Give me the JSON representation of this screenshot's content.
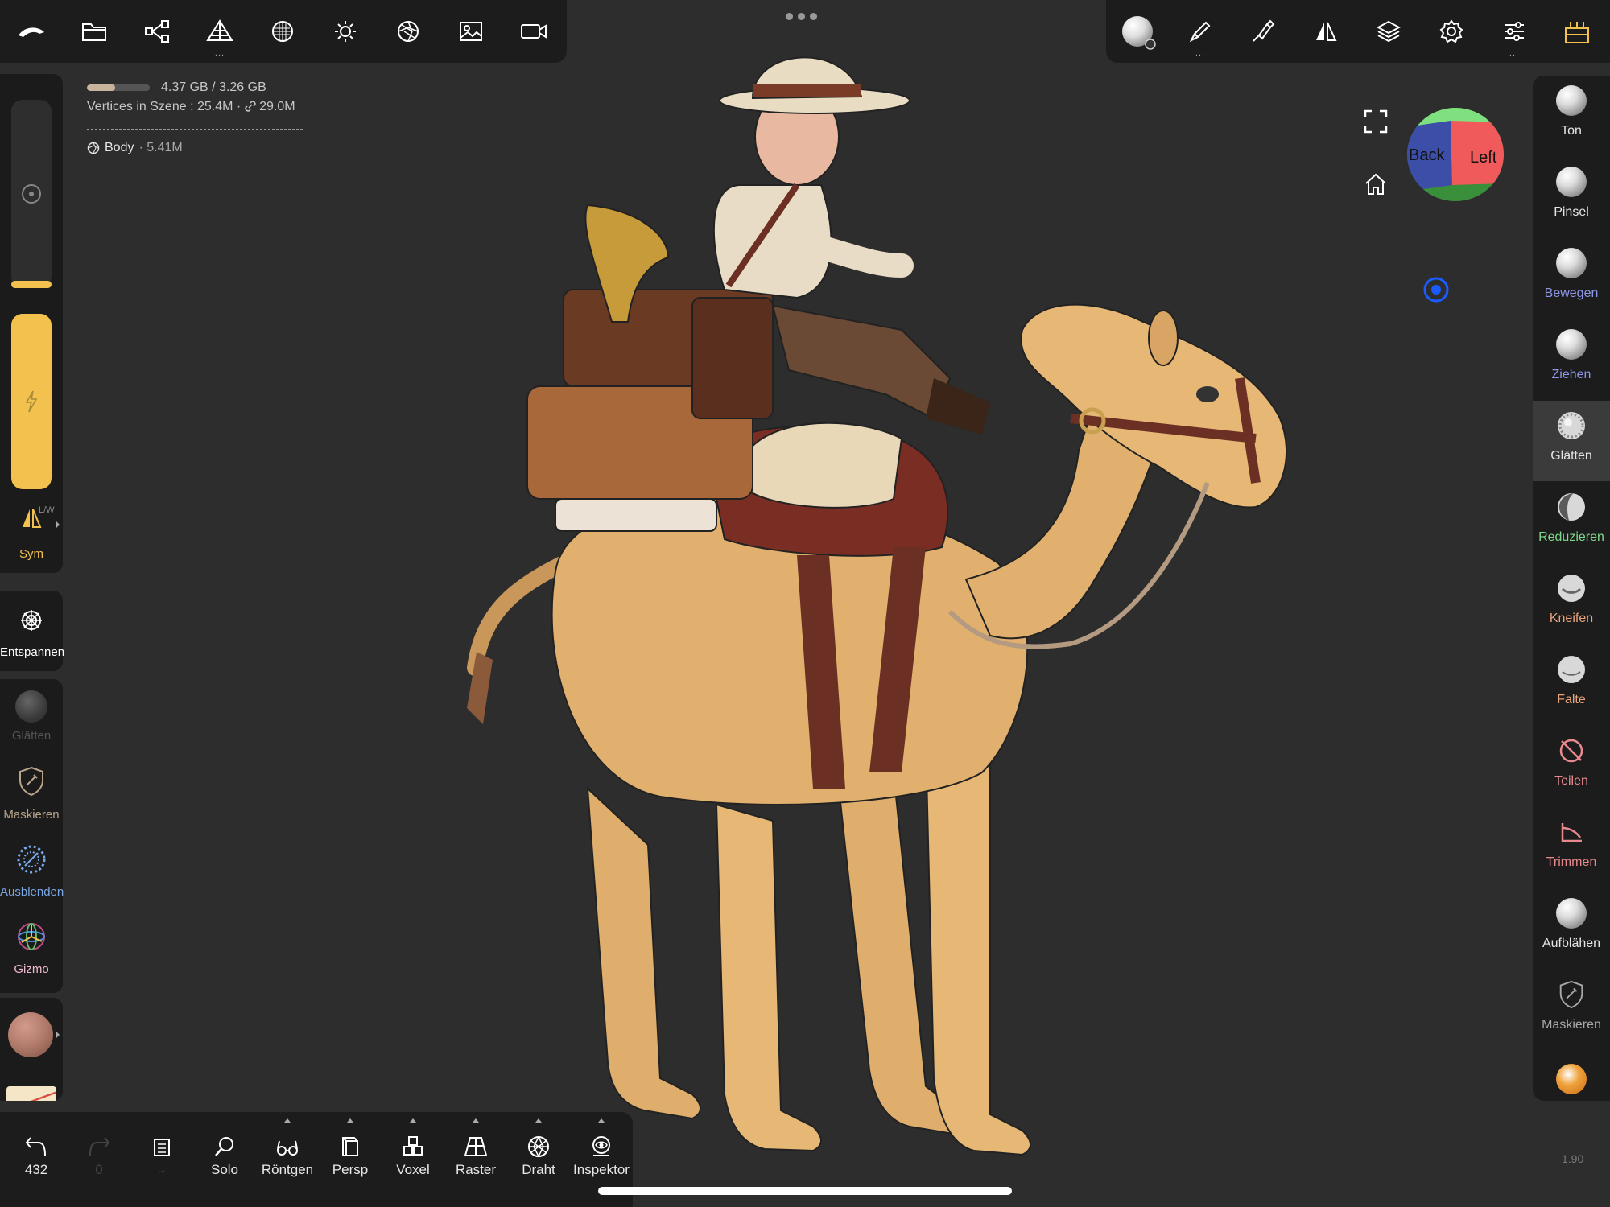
{
  "top_left_toolbar": {
    "icons": [
      "nomad-logo-icon",
      "folder-icon",
      "scene-graph-icon",
      "topology-icon",
      "material-icon",
      "light-icon",
      "shading-icon",
      "background-icon",
      "camera-icon"
    ]
  },
  "top_right_toolbar": {
    "icons": [
      "current-brush-icon",
      "paint-brush-icon",
      "stroke-icon",
      "symmetry-icon",
      "layers-icon",
      "settings-icon",
      "interface-icon",
      "postprocess-icon"
    ]
  },
  "info": {
    "memory": "4.37 GB / 3.26 GB",
    "memory_fraction": 0.45,
    "vertices": "Vertices in Szene :  25.4M ·",
    "vertices_linked": "29.0M",
    "object_name": "Body",
    "object_size": "· 5.41M"
  },
  "left_panel": {
    "sym_label": "Sym",
    "sym_mode": "L/W",
    "relax_label": "Entspannen",
    "smooth_label": "Glätten",
    "mask_label": "Maskieren",
    "hide_label": "Ausblenden",
    "gizmo_label": "Gizmo",
    "radius_level": 0.04,
    "intensity_level": 1.0
  },
  "right_panel": {
    "tools": [
      {
        "label": "Ton",
        "color": "#e6e6e6"
      },
      {
        "label": "Pinsel",
        "color": "#e6e6e6"
      },
      {
        "label": "Bewegen",
        "color": "#8d97e8"
      },
      {
        "label": "Ziehen",
        "color": "#8d97e8"
      },
      {
        "label": "Glätten",
        "color": "#e6e6e6"
      },
      {
        "label": "Reduzieren",
        "color": "#7ed98a"
      },
      {
        "label": "Kneifen",
        "color": "#e8a37a"
      },
      {
        "label": "Falte",
        "color": "#e8a37a"
      },
      {
        "label": "Teilen",
        "color": "#e8898e"
      },
      {
        "label": "Trimmen",
        "color": "#e8898e"
      },
      {
        "label": "Aufblähen",
        "color": "#e6e6e6"
      },
      {
        "label": "Maskieren",
        "color": "#a8a8a8"
      }
    ]
  },
  "bottom_bar": {
    "undo_count": "432",
    "redo_count": "0",
    "history_more": "...",
    "items": [
      "Solo",
      "Röntgen",
      "Persp",
      "Voxel",
      "Raster",
      "Draht",
      "Inspektor"
    ]
  },
  "view_cube": {
    "back": "Back",
    "left": "Left"
  },
  "version": "1.90",
  "colors": {
    "accent_yellow": "#f2c14e",
    "material_sphere": "#b07a6a",
    "camel": "#d9a865"
  }
}
